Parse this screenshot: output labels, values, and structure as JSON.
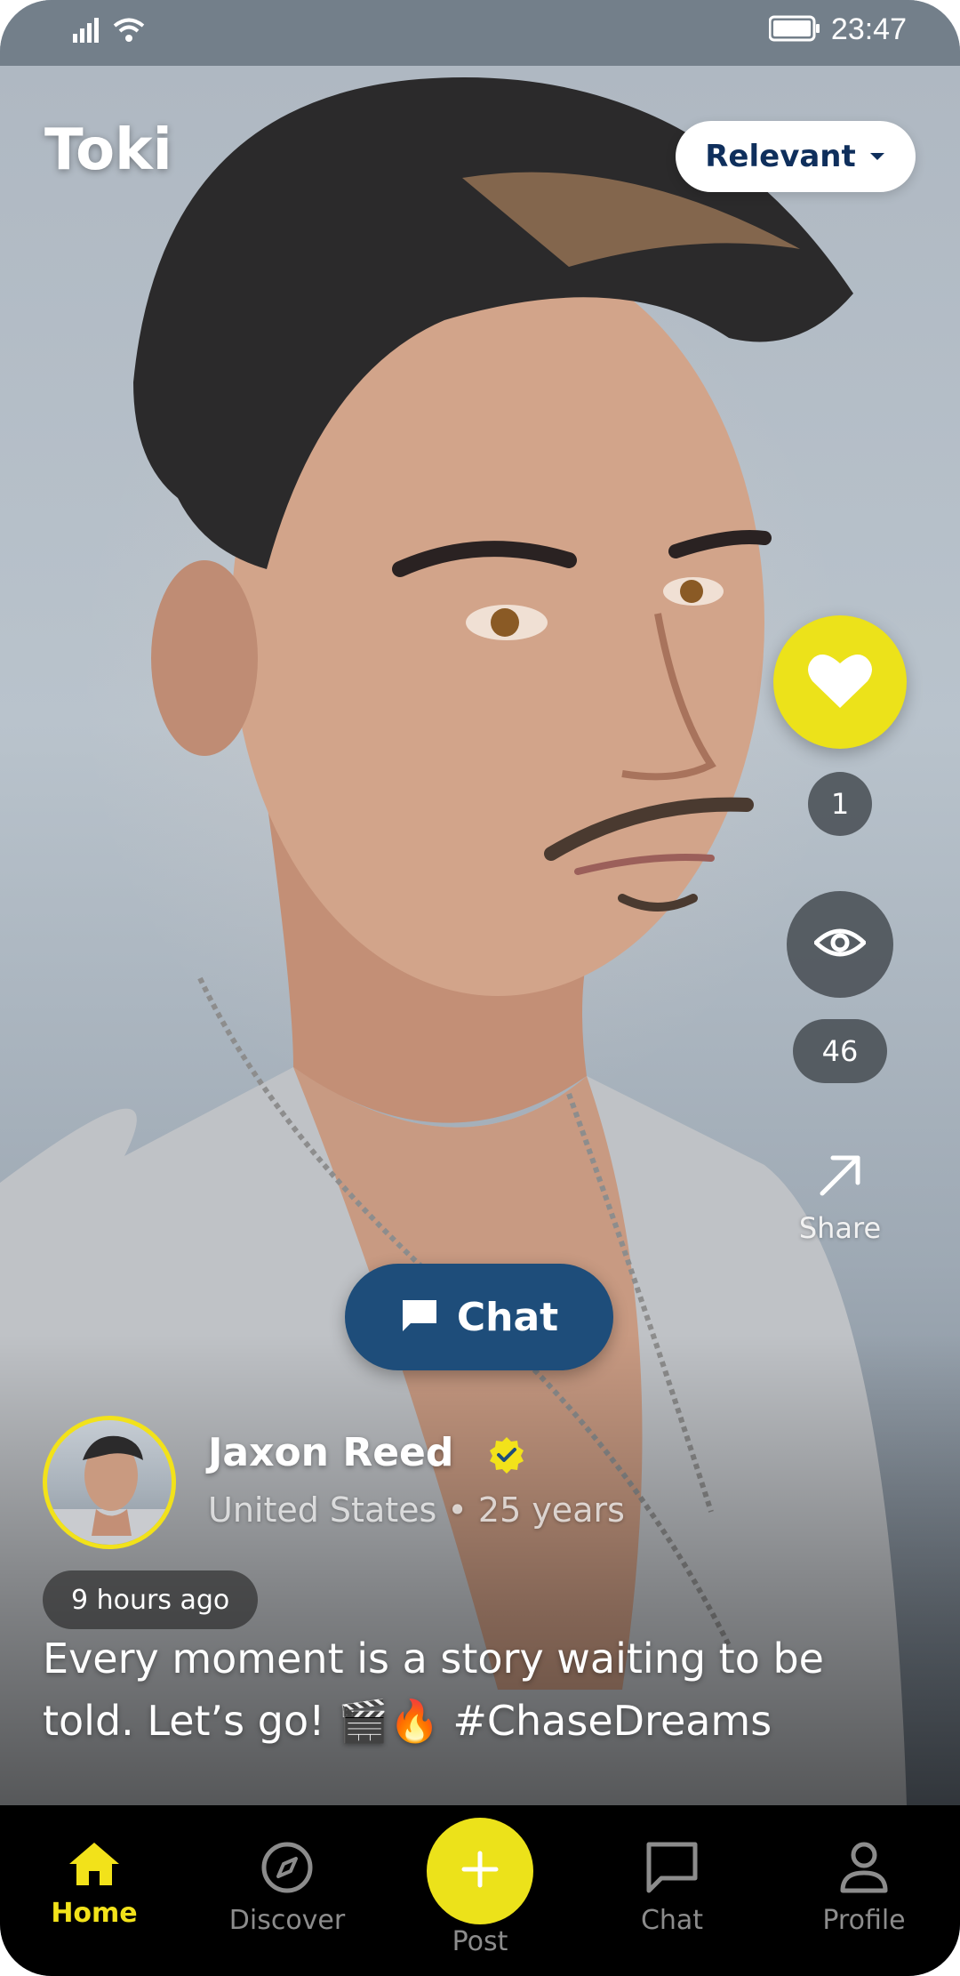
{
  "status_bar": {
    "time": "23:47"
  },
  "header": {
    "app_title": "Toki",
    "sort_label": "Relevant"
  },
  "actions": {
    "like_count": "1",
    "view_count": "46",
    "share_label": "Share"
  },
  "cta": {
    "chat_label": "Chat"
  },
  "post": {
    "author_name": "Jaxon Reed",
    "author_meta": "United States • 25 years",
    "time_ago": "9 hours ago",
    "caption": "Every moment is a story waiting to be told. Let’s go! 🎬🔥 #ChaseDreams"
  },
  "bottom_nav": {
    "home": "Home",
    "discover": "Discover",
    "post": "Post",
    "chat": "Chat",
    "profile": "Profile"
  },
  "colors": {
    "accent_yellow": "#ECE21A",
    "chat_button": "#1E4D7A",
    "sort_text": "#0F2F5C"
  },
  "icons": [
    "signal-icon",
    "wifi-icon",
    "battery-icon",
    "chevron-down-icon",
    "heart-icon",
    "eye-icon",
    "share-arrow-icon",
    "chat-bubble-icon",
    "verified-badge-icon",
    "home-icon",
    "compass-icon",
    "plus-icon",
    "chat-icon",
    "profile-icon"
  ]
}
